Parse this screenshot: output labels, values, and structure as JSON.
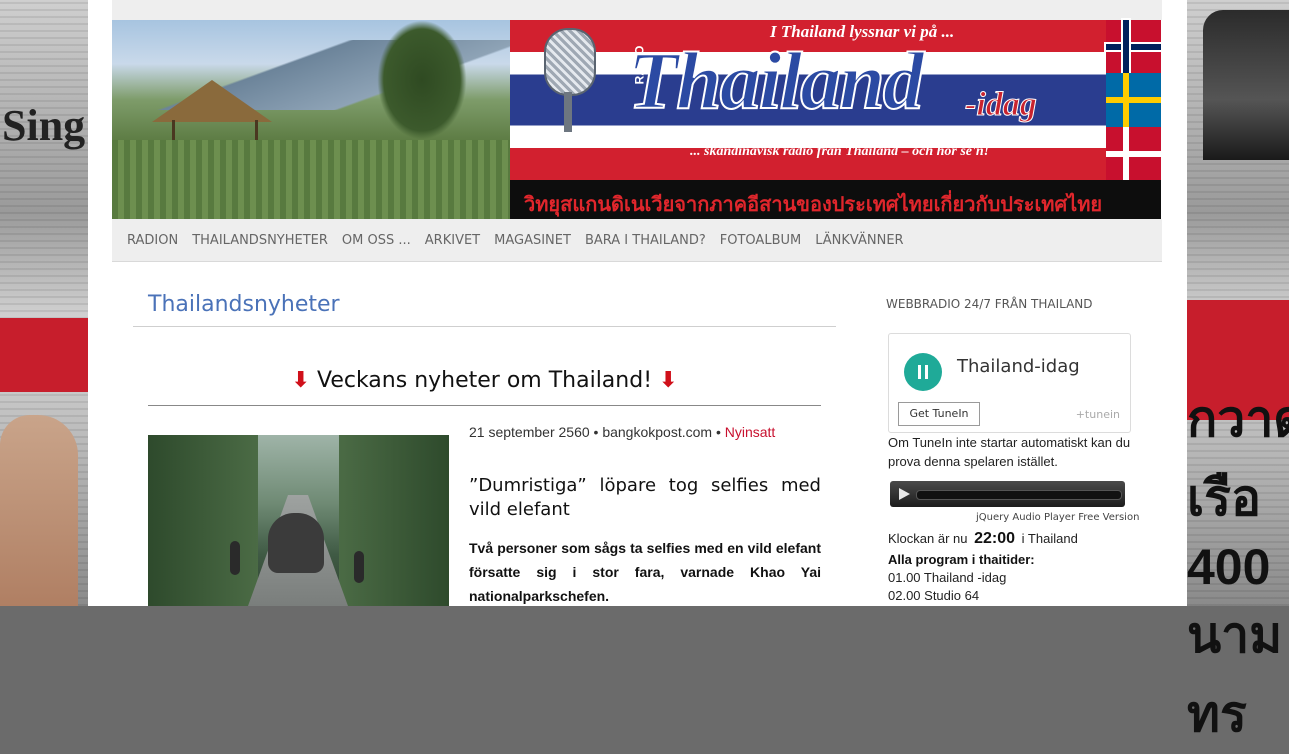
{
  "banner": {
    "tagline_top": "I Thailand lyssnar vi på ...",
    "radio_label": "RADIO",
    "title": "Thailand",
    "title_suffix": "-idag",
    "tagline_bottom": "... skandinavisk radio från Thailand – och hör se'n!",
    "thai_text": "วิทยุสแกนดิเนเวียจากภาคอีสานของประเทศไทยเกี่ยวกับประเทศไทย"
  },
  "nav": {
    "items": [
      "RADION",
      "THAILANDSNYHETER",
      "OM OSS ...",
      "ARKIVET",
      "MAGASINET",
      "BARA I THAILAND?",
      "FOTOALBUM",
      "LÄNKVÄNNER"
    ]
  },
  "main": {
    "section_title": "Thailandsnyheter",
    "headline": "Veckans nyheter om Thailand!",
    "headline_arrow": "⬇",
    "article": {
      "date": "21 september 2560",
      "source": "bangkokpost.com",
      "separator": "•",
      "tag": "Nyinsatt",
      "title": "”Dumristiga” löpare tog selfies med vild elefant",
      "lead": "Två personer som sågs ta selfies med en vild elefant försatte sig i stor fara, varnade Khao Yai nationalparkschefen."
    }
  },
  "sidebar": {
    "widget_title": "WEBBRADIO 24/7 FRÅN THAILAND",
    "station_name": "Thailand-idag",
    "get_tunein": "Get TuneIn",
    "tunein_logo": "+tunein",
    "fallback_text": "Om TuneIn inte startar automatiskt kan du prova denna spelaren istället.",
    "player_caption": "jQuery Audio Player Free Version",
    "clock_prefix": "Klockan är nu",
    "clock_time": "22:00",
    "clock_suffix": "i Thailand",
    "schedule_title": "Alla program i thaitider:",
    "schedule": [
      "01.00 Thailand -idag",
      "02.00 Studio 64"
    ]
  },
  "background": {
    "left_text": "Sing",
    "right_text": "กวาดเรือ 400 นามทร"
  },
  "colors": {
    "accent_blue": "#4a72b8",
    "tunein_green": "#1faa98",
    "arrow_red": "#d0101a",
    "tag_red": "#c8102e"
  }
}
